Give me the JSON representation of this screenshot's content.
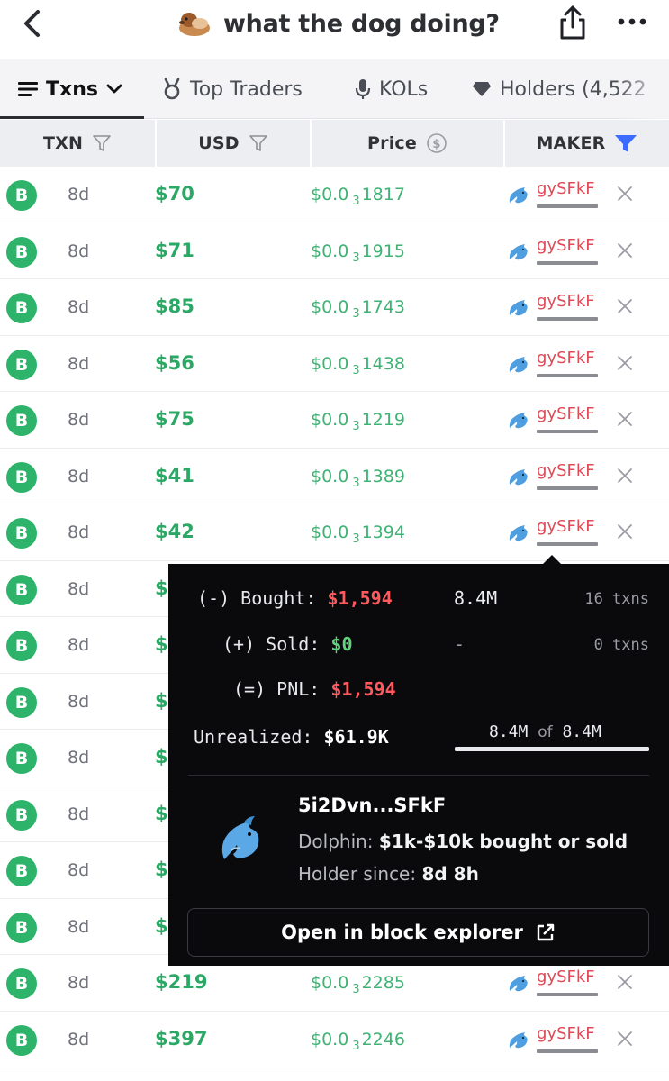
{
  "header": {
    "title": "what the dog doing?"
  },
  "tabs": [
    {
      "label": "Txns",
      "icon": "list-icon",
      "active": true
    },
    {
      "label": "Top Traders",
      "icon": "medal-icon",
      "active": false
    },
    {
      "label": "KOLs",
      "icon": "microphone-icon",
      "active": false
    },
    {
      "label": "Holders (4,522",
      "icon": "diamond-icon",
      "active": false
    }
  ],
  "columns": {
    "txn": "TXN",
    "usd": "USD",
    "price": "Price",
    "maker": "MAKER"
  },
  "colors": {
    "buy_green": "#2eb36b",
    "usd_green": "#2ba865",
    "maker_red": "#e04a57",
    "filter_active_blue": "#3b6bff",
    "popover_bg": "#0a0a0c",
    "loss_red": "#ff5a5f",
    "zero_green": "#62d27f"
  },
  "rows": [
    {
      "type": "B",
      "age": "8d",
      "usd": "$70",
      "price_prefix": "$0.0",
      "price_zeros": "3",
      "price_digits": "1817",
      "maker": "gySFkF"
    },
    {
      "type": "B",
      "age": "8d",
      "usd": "$71",
      "price_prefix": "$0.0",
      "price_zeros": "3",
      "price_digits": "1915",
      "maker": "gySFkF"
    },
    {
      "type": "B",
      "age": "8d",
      "usd": "$85",
      "price_prefix": "$0.0",
      "price_zeros": "3",
      "price_digits": "1743",
      "maker": "gySFkF"
    },
    {
      "type": "B",
      "age": "8d",
      "usd": "$56",
      "price_prefix": "$0.0",
      "price_zeros": "3",
      "price_digits": "1438",
      "maker": "gySFkF"
    },
    {
      "type": "B",
      "age": "8d",
      "usd": "$75",
      "price_prefix": "$0.0",
      "price_zeros": "3",
      "price_digits": "1219",
      "maker": "gySFkF"
    },
    {
      "type": "B",
      "age": "8d",
      "usd": "$41",
      "price_prefix": "$0.0",
      "price_zeros": "3",
      "price_digits": "1389",
      "maker": "gySFkF"
    },
    {
      "type": "B",
      "age": "8d",
      "usd": "$42",
      "price_prefix": "$0.0",
      "price_zeros": "3",
      "price_digits": "1394",
      "maker": "gySFkF"
    },
    {
      "type": "B",
      "age": "8d",
      "usd": "$",
      "price_prefix": "",
      "price_zeros": "",
      "price_digits": "",
      "maker": ""
    },
    {
      "type": "B",
      "age": "8d",
      "usd": "$",
      "price_prefix": "",
      "price_zeros": "",
      "price_digits": "",
      "maker": ""
    },
    {
      "type": "B",
      "age": "8d",
      "usd": "$",
      "price_prefix": "",
      "price_zeros": "",
      "price_digits": "",
      "maker": ""
    },
    {
      "type": "B",
      "age": "8d",
      "usd": "$",
      "price_prefix": "",
      "price_zeros": "",
      "price_digits": "",
      "maker": ""
    },
    {
      "type": "B",
      "age": "8d",
      "usd": "$",
      "price_prefix": "",
      "price_zeros": "",
      "price_digits": "",
      "maker": ""
    },
    {
      "type": "B",
      "age": "8d",
      "usd": "$",
      "price_prefix": "",
      "price_zeros": "",
      "price_digits": "",
      "maker": ""
    },
    {
      "type": "B",
      "age": "8d",
      "usd": "$",
      "price_prefix": "",
      "price_zeros": "",
      "price_digits": "",
      "maker": ""
    },
    {
      "type": "B",
      "age": "8d",
      "usd": "$219",
      "price_prefix": "$0.0",
      "price_zeros": "3",
      "price_digits": "2285",
      "maker": "gySFkF"
    },
    {
      "type": "B",
      "age": "8d",
      "usd": "$397",
      "price_prefix": "$0.0",
      "price_zeros": "3",
      "price_digits": "2246",
      "maker": "gySFkF"
    }
  ],
  "popover": {
    "bought_label": "(-) Bought:",
    "bought_usd": "$1,594",
    "bought_tokens": "8.4M",
    "bought_txns": "16 txns",
    "sold_label": "(+) Sold:",
    "sold_usd": "$0",
    "sold_tokens": "-",
    "sold_txns": "0 txns",
    "pnl_label": "(=) PNL:",
    "pnl_usd": "$1,594",
    "unrealized_label": "Unrealized:",
    "unrealized_usd": "$61.9K",
    "holding_amount": "8.4M",
    "holding_of": "of",
    "holding_total": "8.4M",
    "holding_fraction": 1.0,
    "address": "5i2Dvn...SFkF",
    "tier_label": "Dolphin:",
    "tier_value": "$1k-$10k bought or sold",
    "holder_label": "Holder since:",
    "holder_value": "8d 8h",
    "explorer_button": "Open in block explorer"
  }
}
